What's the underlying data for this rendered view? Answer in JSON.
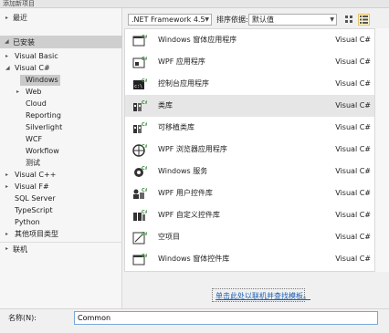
{
  "window": {
    "title": "添加新项目"
  },
  "left_panel": {
    "recent": "最近",
    "installed": "已安装",
    "tree": [
      {
        "label": "Visual Basic",
        "expander": "▸",
        "indent": 1
      },
      {
        "label": "Visual C#",
        "expander": "◢",
        "indent": 1
      },
      {
        "label": "Windows",
        "expander": "",
        "indent": 2,
        "selected": true
      },
      {
        "label": "Web",
        "expander": "▸",
        "indent": 2
      },
      {
        "label": "Cloud",
        "expander": "",
        "indent": 2
      },
      {
        "label": "Reporting",
        "expander": "",
        "indent": 2
      },
      {
        "label": "Silverlight",
        "expander": "",
        "indent": 2
      },
      {
        "label": "WCF",
        "expander": "",
        "indent": 2
      },
      {
        "label": "Workflow",
        "expander": "",
        "indent": 2
      },
      {
        "label": "测试",
        "expander": "",
        "indent": 2
      },
      {
        "label": "Visual C++",
        "expander": "▸",
        "indent": 1
      },
      {
        "label": "Visual F#",
        "expander": "▸",
        "indent": 1
      },
      {
        "label": "SQL Server",
        "expander": "",
        "indent": 1
      },
      {
        "label": "TypeScript",
        "expander": "",
        "indent": 1
      },
      {
        "label": "Python",
        "expander": "",
        "indent": 1
      },
      {
        "label": "其他项目类型",
        "expander": "▸",
        "indent": 1
      }
    ],
    "online": "联机"
  },
  "toolbar": {
    "framework": ".NET Framework 4.5",
    "sort_label": "排序依据:",
    "sort_value": "默认值"
  },
  "templates": [
    {
      "name": "Windows 窗体应用程序",
      "lang": "Visual C#",
      "icon": "winforms-app-icon"
    },
    {
      "name": "WPF 应用程序",
      "lang": "Visual C#",
      "icon": "wpf-app-icon"
    },
    {
      "name": "控制台应用程序",
      "lang": "Visual C#",
      "icon": "console-app-icon"
    },
    {
      "name": "类库",
      "lang": "Visual C#",
      "icon": "class-library-icon",
      "selected": true
    },
    {
      "name": "可移植类库",
      "lang": "Visual C#",
      "icon": "portable-library-icon"
    },
    {
      "name": "WPF 浏览器应用程序",
      "lang": "Visual C#",
      "icon": "wpf-browser-app-icon"
    },
    {
      "name": "Windows 服务",
      "lang": "Visual C#",
      "icon": "windows-service-icon"
    },
    {
      "name": "WPF 用户控件库",
      "lang": "Visual C#",
      "icon": "wpf-user-control-icon"
    },
    {
      "name": "WPF 自定义控件库",
      "lang": "Visual C#",
      "icon": "wpf-custom-control-icon"
    },
    {
      "name": "空项目",
      "lang": "Visual C#",
      "icon": "empty-project-icon"
    },
    {
      "name": "Windows 窗体控件库",
      "lang": "Visual C#",
      "icon": "winforms-control-icon"
    }
  ],
  "online_link": "单击此处以联机并查找模板。",
  "name_field": {
    "label": "名称(N):",
    "value": "Common"
  },
  "colors": {
    "csharp_badge": "#3f8f3f",
    "link": "#1a5fb4",
    "selection": "#e6e6e6"
  }
}
